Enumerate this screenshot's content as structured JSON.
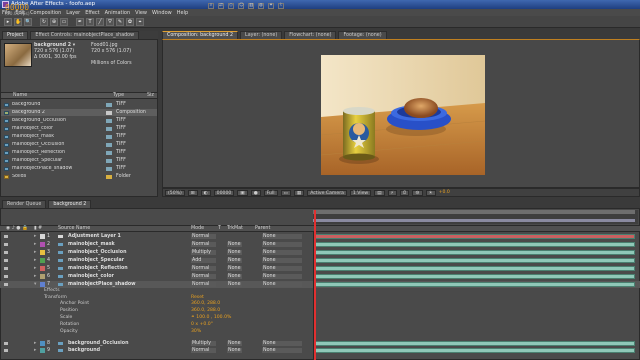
{
  "title": "Adobe After Effects - foofo.aep",
  "menu": [
    "File",
    "Edit",
    "Composition",
    "Layer",
    "Effect",
    "Animation",
    "View",
    "Window",
    "Help"
  ],
  "tools": [
    "▸",
    "✋",
    "🔍",
    "↻",
    "⊕",
    "▭",
    "✒",
    "T",
    "╱",
    "⛛",
    "✎",
    "✿",
    "⌖"
  ],
  "left_tabs": [
    "Project",
    "Effect Controls: mainobjectPlace_shadow"
  ],
  "project": {
    "selected_name": "background 2 ▾",
    "dims": "720 x 576 (1.07)",
    "duration": "Δ 0001, 30.00 fps",
    "file": "Food01.jpg",
    "file_dims": "720 x 576 (1.07)",
    "colors": "Millions of Colors",
    "col_name": "Name",
    "col_type": "Type",
    "col_size": "Siz",
    "items": [
      {
        "name": "background",
        "type": "TIFF",
        "kind": "file"
      },
      {
        "name": "background 2",
        "type": "Composition",
        "kind": "comp"
      },
      {
        "name": "background_Occlusion",
        "type": "TIFF",
        "kind": "file"
      },
      {
        "name": "mainobject_color",
        "type": "TIFF",
        "kind": "file"
      },
      {
        "name": "mainobject_mask",
        "type": "TIFF",
        "kind": "file"
      },
      {
        "name": "mainobject_Occlusion",
        "type": "TIFF",
        "kind": "file"
      },
      {
        "name": "mainobject_Reflection",
        "type": "TIFF",
        "kind": "file"
      },
      {
        "name": "mainobject_Specular",
        "type": "TIFF",
        "kind": "file"
      },
      {
        "name": "mainobjectPlace_shadow",
        "type": "TIFF",
        "kind": "file"
      },
      {
        "name": "Solids",
        "type": "Folder",
        "kind": "folder"
      }
    ],
    "bpc": "8 bpc"
  },
  "comp_tabs": [
    "Composition: background 2",
    "Layer: (none)",
    "Flowchart: (none)",
    "Footage: (none)"
  ],
  "viewer_footer": {
    "zoom": "(50%)",
    "time": "00000",
    "res": "Full",
    "camera": "Active Camera",
    "views": "1 View",
    "exposure": "+0.0"
  },
  "timeline_tabs": [
    "Render Queue",
    "background 2"
  ],
  "timecode": "00000",
  "fps": "(30.00 fps)",
  "columns": {
    "source": "Source Name",
    "mode": "Mode",
    "t": "T",
    "trkmat": "TrkMat",
    "parent": "Parent"
  },
  "layers": [
    {
      "num": "1",
      "name": "Adjustment Layer 1",
      "mode": "Normal",
      "trk": "",
      "parent": "None",
      "label": "#d8d8d8",
      "bar": "#c86060",
      "icon": "#d8d8d8"
    },
    {
      "num": "2",
      "name": "mainobject_mask",
      "mode": "Normal",
      "trk": "None",
      "parent": "None",
      "label": "#b050b0",
      "bar": "#8fc8b8",
      "icon": "#6aa0c0"
    },
    {
      "num": "3",
      "name": "mainobject_Occlusion",
      "mode": "Multiply",
      "trk": "None",
      "parent": "None",
      "label": "#e8c040",
      "bar": "#8fc8b8",
      "icon": "#6aa0c0"
    },
    {
      "num": "4",
      "name": "mainobject_Specular",
      "mode": "Add",
      "trk": "None",
      "parent": "None",
      "label": "#50a050",
      "bar": "#8fc8b8",
      "icon": "#6aa0c0"
    },
    {
      "num": "5",
      "name": "mainobject_Reflection",
      "mode": "Normal",
      "trk": "None",
      "parent": "None",
      "label": "#d06060",
      "bar": "#8fc8b8",
      "icon": "#6aa0c0"
    },
    {
      "num": "6",
      "name": "mainobject_color",
      "mode": "Normal",
      "trk": "None",
      "parent": "None",
      "label": "#b0a070",
      "bar": "#8fc8b8",
      "icon": "#6aa0c0"
    },
    {
      "num": "7",
      "name": "mainobjectPlace_shadow",
      "mode": "Normal",
      "trk": "None",
      "parent": "None",
      "label": "#6080d0",
      "bar": "#8fc8b8",
      "icon": "#6aa0c0"
    },
    {
      "num": "8",
      "name": "background_Occlusion",
      "mode": "Multiply",
      "trk": "None",
      "parent": "None",
      "label": "#5090c0",
      "bar": "#8fc8b8",
      "icon": "#6aa0c0"
    },
    {
      "num": "9",
      "name": "background",
      "mode": "Normal",
      "trk": "None",
      "parent": "None",
      "label": "#50a0a0",
      "bar": "#8fc8b8",
      "icon": "#6aa0c0"
    }
  ],
  "props": {
    "effects": "Effects",
    "transform": "Transform",
    "reset": "Reset",
    "items": [
      {
        "name": "Anchor Point",
        "value": "360.0, 288.0"
      },
      {
        "name": "Position",
        "value": "360.0, 288.0"
      },
      {
        "name": "Scale",
        "value": "⚭ 100.0 , 100.0%"
      },
      {
        "name": "Rotation",
        "value": "0 x +0.0°"
      },
      {
        "name": "Opacity",
        "value": "30%"
      }
    ]
  }
}
